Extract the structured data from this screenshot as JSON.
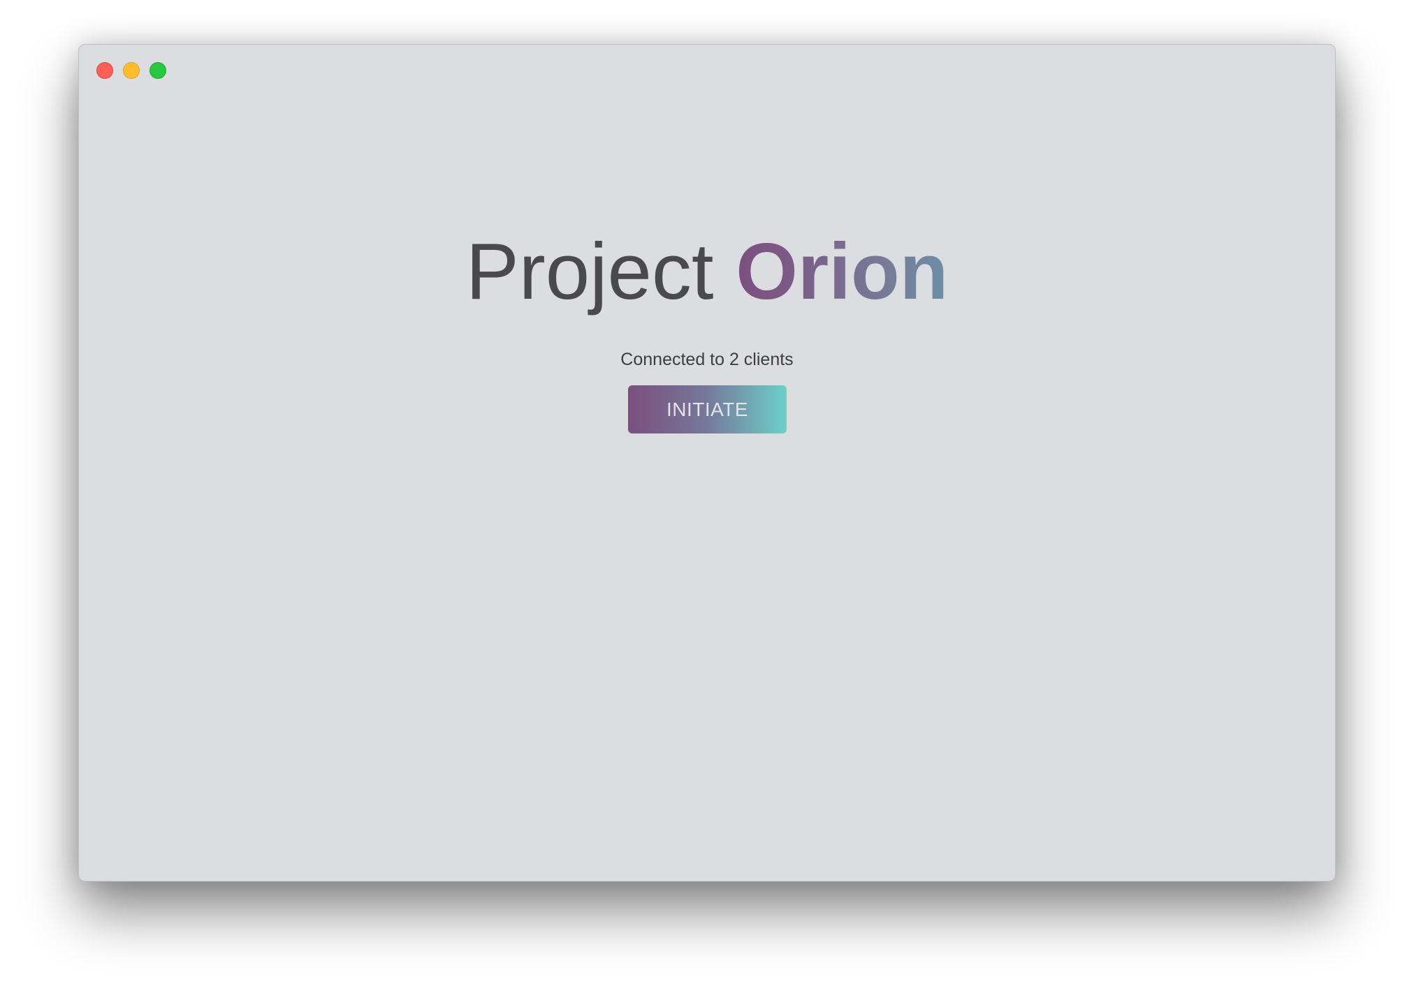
{
  "window": {
    "controls": {
      "close_icon": "close-traffic-light-icon",
      "minimize_icon": "minimize-traffic-light-icon",
      "maximize_icon": "maximize-traffic-light-icon",
      "colors": {
        "close": "#fe5f57",
        "minimize": "#febc2e",
        "maximize": "#28c840"
      }
    },
    "background": "#dcdde1"
  },
  "main": {
    "title_plain": "Project",
    "title_accent": "Orion",
    "status_text": "Connected to 2 clients",
    "initiate_label": "INITIATE"
  },
  "colors": {
    "text": "#4a4a4c",
    "accent_gradient_start": "#7b4f7f",
    "accent_gradient_end": "#6cd0c7"
  }
}
